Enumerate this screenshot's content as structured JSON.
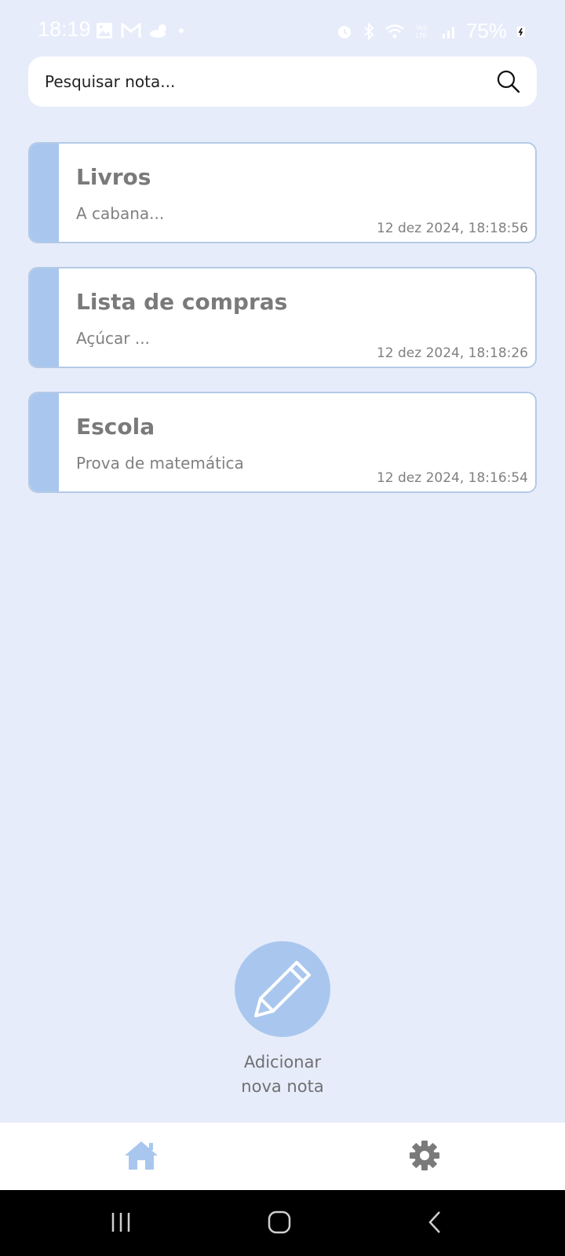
{
  "status_bar": {
    "time": "18:19",
    "battery": "75%",
    "icons_left": [
      "gallery-icon",
      "gmail-icon",
      "weather-icon",
      "dot-icon"
    ],
    "icons_right": [
      "alarm-icon",
      "bluetooth-icon",
      "wifi-icon",
      "volte-icon",
      "signal-icon",
      "charging-icon"
    ]
  },
  "search": {
    "placeholder": "Pesquisar nota...",
    "icon": "search-icon"
  },
  "notes": [
    {
      "title": "Livros",
      "preview": "A cabana...",
      "date": "12 dez 2024, 18:18:56"
    },
    {
      "title": "Lista de compras",
      "preview": "Açúcar ...",
      "date": "12 dez 2024, 18:18:26"
    },
    {
      "title": "Escola",
      "preview": "Prova de matemática",
      "date": "12 dez 2024, 18:16:54"
    }
  ],
  "fab": {
    "icon": "pencil-icon",
    "label_line1": "Adicionar",
    "label_line2": "nova nota"
  },
  "bottom_nav": {
    "items": [
      {
        "icon": "home-icon",
        "active": true
      },
      {
        "icon": "gear-icon",
        "active": false
      }
    ]
  },
  "colors": {
    "background": "#e7ecfb",
    "accent": "#a9c7ee",
    "card_border": "#b4cae6",
    "text_gray": "#7a7a7a"
  }
}
